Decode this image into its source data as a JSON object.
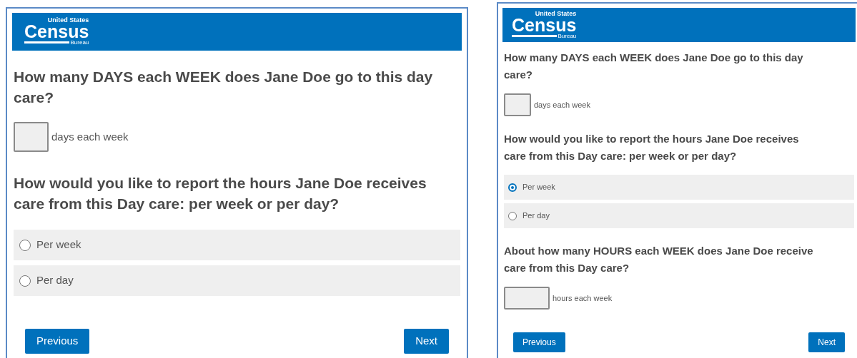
{
  "panels": [
    {
      "logo": {
        "top": "United States",
        "main": "Census",
        "bottom": "Bureau"
      },
      "questions": [
        {
          "kind": "number",
          "text": "How many DAYS each WEEK does Jane Doe go to this day care?",
          "unit": "days each week"
        },
        {
          "kind": "choice",
          "text": "How would you like to report the hours Jane Doe receives care from this Day care: per week or per day?",
          "options": [
            {
              "label": "Per week",
              "selected": false
            },
            {
              "label": "Per day",
              "selected": false
            }
          ]
        }
      ],
      "buttons": [
        "Previous",
        "Next"
      ]
    },
    {
      "logo": {
        "top": "United States",
        "main": "Census",
        "bottom": "Bureau"
      },
      "questions": [
        {
          "kind": "number",
          "text": "How many DAYS each WEEK does Jane Doe go to this day care?",
          "unit": "days each week"
        },
        {
          "kind": "choice",
          "text": "How would you like to report the hours Jane Doe receives care from this Day care: per week or per day?",
          "options": [
            {
              "label": "Per week",
              "selected": true
            },
            {
              "label": "Per day",
              "selected": false
            }
          ]
        },
        {
          "kind": "wide-number",
          "text": "About how many HOURS each WEEK does Jane Doe receive care from this Day care?",
          "unit": "hours each week"
        }
      ],
      "buttons": [
        "Previous",
        "Next"
      ]
    }
  ]
}
